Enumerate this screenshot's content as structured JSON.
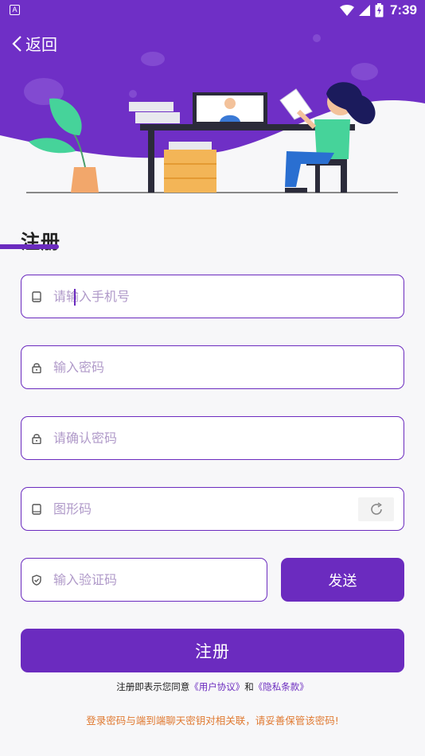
{
  "status_bar": {
    "app_badge": "A",
    "time": "7:39",
    "icons": [
      "wifi-icon",
      "cell-signal-icon",
      "battery-charging-icon"
    ]
  },
  "header": {
    "back_label": "返回",
    "illustration": "person-at-desk-illustration"
  },
  "form": {
    "title": "注册",
    "fields": [
      {
        "name": "phone",
        "placeholder": "请输入手机号",
        "value": "",
        "icon": "phone-icon"
      },
      {
        "name": "password",
        "placeholder": "输入密码",
        "value": "",
        "icon": "lock-icon"
      },
      {
        "name": "confirm_password",
        "placeholder": "请确认密码",
        "value": "",
        "icon": "lock-icon"
      },
      {
        "name": "captcha",
        "placeholder": "图形码",
        "value": "",
        "icon": "phone-icon"
      },
      {
        "name": "sms_code",
        "placeholder": "输入验证码",
        "value": "",
        "icon": "shield-check-icon"
      }
    ],
    "send_label": "发送",
    "submit_label": "注册"
  },
  "agreement": {
    "prefix": "注册即表示您同意",
    "user_agreement": "《用户协议》",
    "and": "和",
    "privacy": "《隐私条款》"
  },
  "warning": "登录密码与端到端聊天密钥对相关联，请妥善保管该密码!",
  "colors": {
    "accent": "#6b2bbf",
    "header_bg": "#6f2fc6",
    "warning": "#e07a32",
    "placeholder": "#b09ac9"
  }
}
